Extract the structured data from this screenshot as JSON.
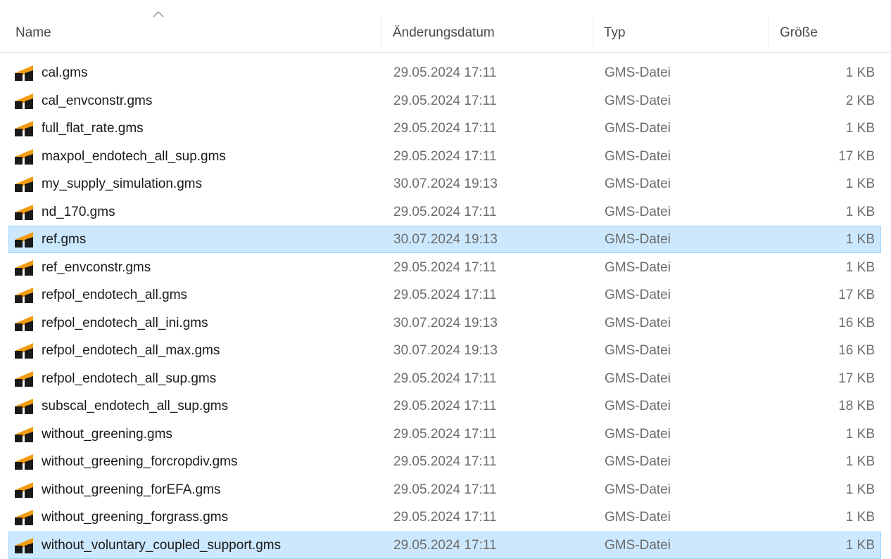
{
  "columns": {
    "name": "Name",
    "date": "Änderungsdatum",
    "type": "Typ",
    "size": "Größe"
  },
  "icons": {
    "sort": "sort-ascending-caret-icon",
    "file": "gams-file-icon",
    "file_colors": {
      "orange": "#f39c12",
      "black": "#1a1a1a"
    }
  },
  "selection": {
    "background": "#cce8ff",
    "border": "#99d1ff"
  },
  "files": [
    {
      "name": "cal.gms",
      "date": "29.05.2024 17:11",
      "type": "GMS-Datei",
      "size": "1 KB",
      "selected": false
    },
    {
      "name": "cal_envconstr.gms",
      "date": "29.05.2024 17:11",
      "type": "GMS-Datei",
      "size": "2 KB",
      "selected": false
    },
    {
      "name": "full_flat_rate.gms",
      "date": "29.05.2024 17:11",
      "type": "GMS-Datei",
      "size": "1 KB",
      "selected": false
    },
    {
      "name": "maxpol_endotech_all_sup.gms",
      "date": "29.05.2024 17:11",
      "type": "GMS-Datei",
      "size": "17 KB",
      "selected": false
    },
    {
      "name": "my_supply_simulation.gms",
      "date": "30.07.2024 19:13",
      "type": "GMS-Datei",
      "size": "1 KB",
      "selected": false
    },
    {
      "name": "nd_170.gms",
      "date": "29.05.2024 17:11",
      "type": "GMS-Datei",
      "size": "1 KB",
      "selected": false
    },
    {
      "name": "ref.gms",
      "date": "30.07.2024 19:13",
      "type": "GMS-Datei",
      "size": "1 KB",
      "selected": true
    },
    {
      "name": "ref_envconstr.gms",
      "date": "29.05.2024 17:11",
      "type": "GMS-Datei",
      "size": "1 KB",
      "selected": false
    },
    {
      "name": "refpol_endotech_all.gms",
      "date": "29.05.2024 17:11",
      "type": "GMS-Datei",
      "size": "17 KB",
      "selected": false
    },
    {
      "name": "refpol_endotech_all_ini.gms",
      "date": "30.07.2024 19:13",
      "type": "GMS-Datei",
      "size": "16 KB",
      "selected": false
    },
    {
      "name": "refpol_endotech_all_max.gms",
      "date": "30.07.2024 19:13",
      "type": "GMS-Datei",
      "size": "16 KB",
      "selected": false
    },
    {
      "name": "refpol_endotech_all_sup.gms",
      "date": "29.05.2024 17:11",
      "type": "GMS-Datei",
      "size": "17 KB",
      "selected": false
    },
    {
      "name": "subscal_endotech_all_sup.gms",
      "date": "29.05.2024 17:11",
      "type": "GMS-Datei",
      "size": "18 KB",
      "selected": false
    },
    {
      "name": "without_greening.gms",
      "date": "29.05.2024 17:11",
      "type": "GMS-Datei",
      "size": "1 KB",
      "selected": false
    },
    {
      "name": "without_greening_forcropdiv.gms",
      "date": "29.05.2024 17:11",
      "type": "GMS-Datei",
      "size": "1 KB",
      "selected": false
    },
    {
      "name": "without_greening_forEFA.gms",
      "date": "29.05.2024 17:11",
      "type": "GMS-Datei",
      "size": "1 KB",
      "selected": false
    },
    {
      "name": "without_greening_forgrass.gms",
      "date": "29.05.2024 17:11",
      "type": "GMS-Datei",
      "size": "1 KB",
      "selected": false
    },
    {
      "name": "without_voluntary_coupled_support.gms",
      "date": "29.05.2024 17:11",
      "type": "GMS-Datei",
      "size": "1 KB",
      "selected": true
    }
  ]
}
